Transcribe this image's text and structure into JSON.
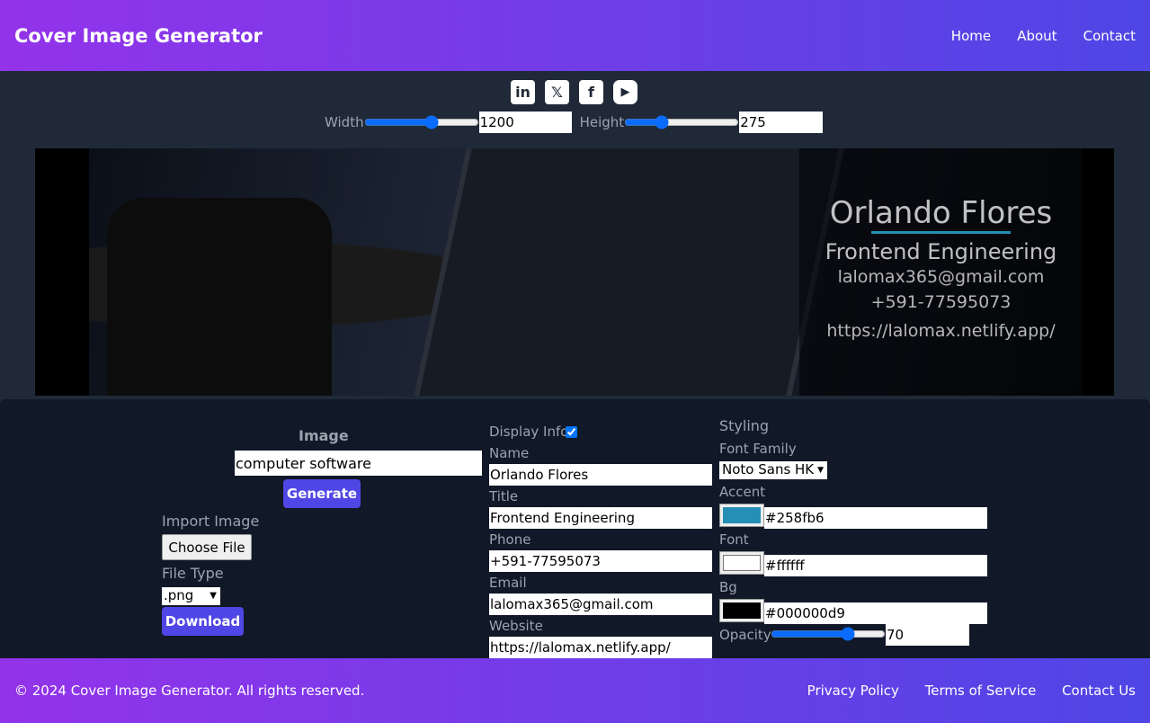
{
  "header": {
    "title": "Cover Image Generator",
    "nav": [
      "Home",
      "About",
      "Contact"
    ]
  },
  "social": [
    "linkedin-icon",
    "x-icon",
    "facebook-icon",
    "youtube-icon"
  ],
  "dimensions": {
    "width_label": "Width",
    "width_value": "1200",
    "width_fraction": 0.6,
    "height_label": "Height",
    "height_value": "275",
    "height_fraction": 0.3
  },
  "preview": {
    "name": "Orlando Flores",
    "title": "Frontend Engineering",
    "email": "lalomax365@gmail.com",
    "phone": "+591-77595073",
    "website": "https://lalomax.netlify.app/"
  },
  "image": {
    "heading": "Image",
    "query": "computer software",
    "generate": "Generate",
    "import_label": "Import Image",
    "choose_file": "Choose File",
    "file_type_label": "File Type",
    "file_type": ".png",
    "download": "Download"
  },
  "info": {
    "display_label": "Display Info",
    "display_checked": true,
    "name_label": "Name",
    "name": "Orlando Flores",
    "title_label": "Title",
    "title": "Frontend Engineering",
    "phone_label": "Phone",
    "phone": "+591-77595073",
    "email_label": "Email",
    "email": "lalomax365@gmail.com",
    "website_label": "Website",
    "website": "https://lalomax.netlify.app/"
  },
  "styling": {
    "heading": "Styling",
    "font_family_label": "Font Family",
    "font_family": "Noto Sans HK",
    "accent_label": "Accent",
    "accent": "#258fb6",
    "font_label": "Font",
    "font": "#ffffff",
    "bg_label": "Bg",
    "bg": "#000000d9",
    "opacity_label": "Opacity",
    "opacity": "70"
  },
  "footer": {
    "copyright": "© 2024 Cover Image Generator. All rights reserved.",
    "links": [
      "Privacy Policy",
      "Terms of Service",
      "Contact Us"
    ]
  }
}
